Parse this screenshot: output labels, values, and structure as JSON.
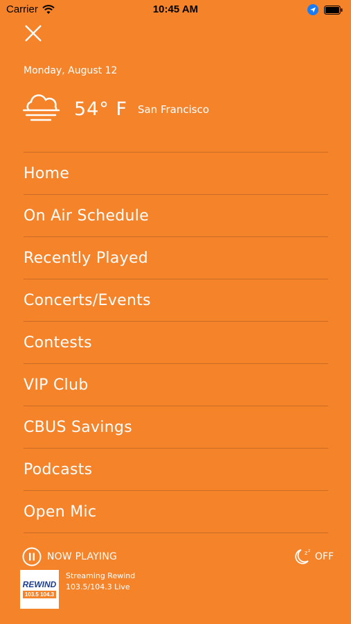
{
  "status_bar": {
    "carrier": "Carrier",
    "time": "10:45 AM"
  },
  "header": {
    "date": "Monday, August 12",
    "weather": {
      "icon": "cloud-fog-icon",
      "temperature": "54° F",
      "city": "San Francisco"
    }
  },
  "menu": {
    "items": [
      {
        "label": "Home"
      },
      {
        "label": "On Air Schedule"
      },
      {
        "label": "Recently Played"
      },
      {
        "label": "Concerts/Events"
      },
      {
        "label": "Contests"
      },
      {
        "label": "VIP Club"
      },
      {
        "label": "CBUS Savings"
      },
      {
        "label": "Podcasts"
      },
      {
        "label": "Open Mic"
      }
    ]
  },
  "player": {
    "now_playing_label": "NOW PLAYING",
    "sleep_timer_label": "OFF",
    "stream_title": "Streaming Rewind",
    "stream_subtitle": "103.5/104.3 Live",
    "logo": {
      "top": "REWIND",
      "bottom": "103.5 104.3"
    }
  },
  "colors": {
    "background": "#F4832A",
    "text": "#FFFFFF"
  }
}
